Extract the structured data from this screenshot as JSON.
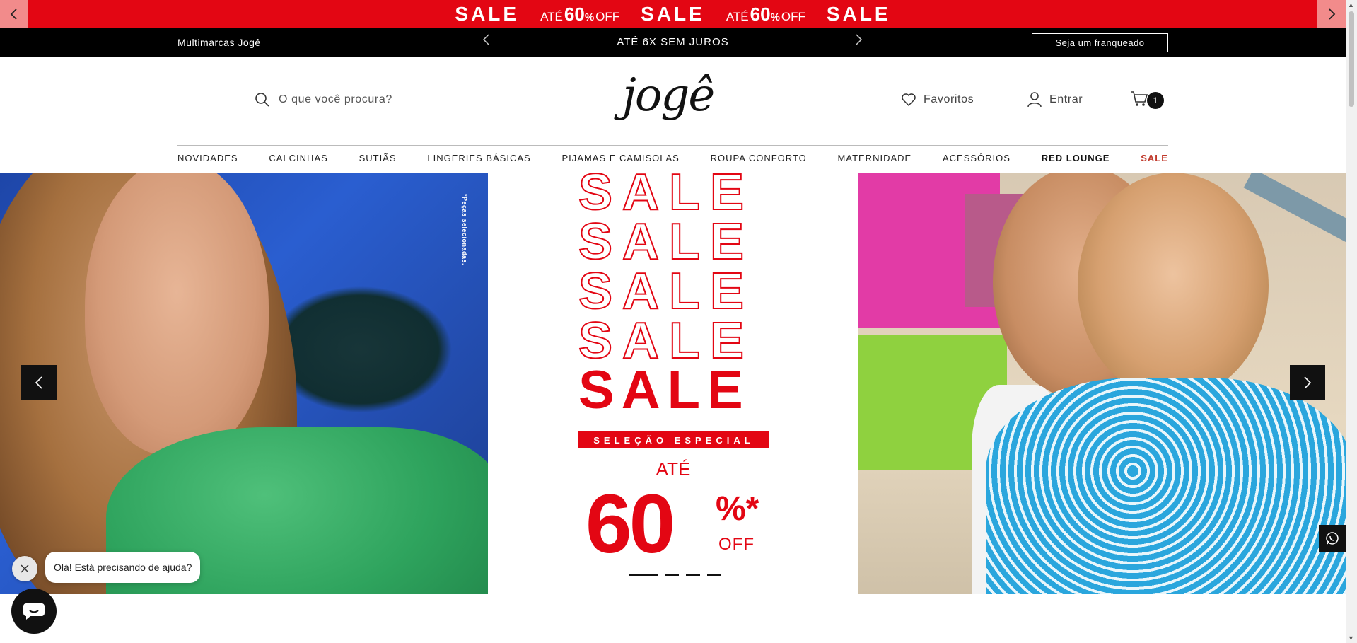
{
  "promo_bar": {
    "sale_word": "SALE",
    "ate_word": "ATÉ",
    "percent_value": "60",
    "percent_sign": "%",
    "off_word": "OFF",
    "prev_icon": "chevron-left-icon",
    "next_icon": "chevron-right-icon",
    "background": "#e30613"
  },
  "info_bar": {
    "brand_link": "Multimarcas Jogê",
    "message": "ATÉ 6X SEM JUROS",
    "franchise_button": "Seja um franqueado"
  },
  "header": {
    "search_placeholder": "O que você procura?",
    "logo_text": "jogê",
    "favorites_label": "Favoritos",
    "login_label": "Entrar",
    "cart_count": "1"
  },
  "nav": {
    "items": [
      "NOVIDADES",
      "CALCINHAS",
      "SUTIÃS",
      "LINGERIES BÁSICAS",
      "PIJAMAS E CAMISOLAS",
      "ROUPA CONFORTO",
      "MATERNIDADE",
      "ACESSÓRIOS",
      "RED LOUNGE",
      "SALE"
    ]
  },
  "hero": {
    "side_note": "*Peças selecionadas.",
    "sale_word": "SALE",
    "selection_label": "SELEÇÃO ESPECIAL",
    "ate_label": "ATÉ",
    "discount_value": "60",
    "discount_symbol": "%*",
    "off_label": "OFF",
    "slide_count": 4,
    "active_slide": 1
  },
  "chat": {
    "greeting": "Olá! Está precisando de ajuda?"
  }
}
